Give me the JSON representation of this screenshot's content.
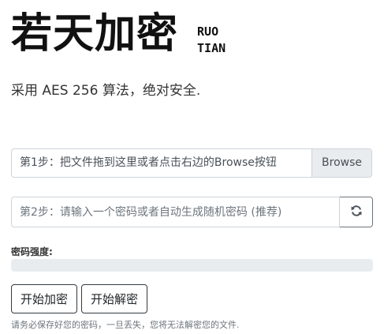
{
  "brand": {
    "title": "若天加密",
    "sub_line1": "RUO",
    "sub_line2": "TIAN"
  },
  "tagline": "采用 AES 256 算法，绝对安全.",
  "file_input": {
    "label": "第1步：把文件拖到这里或者点击右边的Browse按钮",
    "browse_label": "Browse"
  },
  "password": {
    "placeholder": "第2步：请输入一个密码或者自动生成随机密码 (推荐)",
    "value": ""
  },
  "strength": {
    "label": "密码强度:",
    "level": 0
  },
  "actions": {
    "encrypt_label": "开始加密",
    "decrypt_label": "开始解密"
  },
  "warning": "请务必保存好您的密码，一旦丢失，您将无法解密您的文件.",
  "colors": {
    "progress_track": "#e9ecef",
    "border": "#ced4da"
  }
}
